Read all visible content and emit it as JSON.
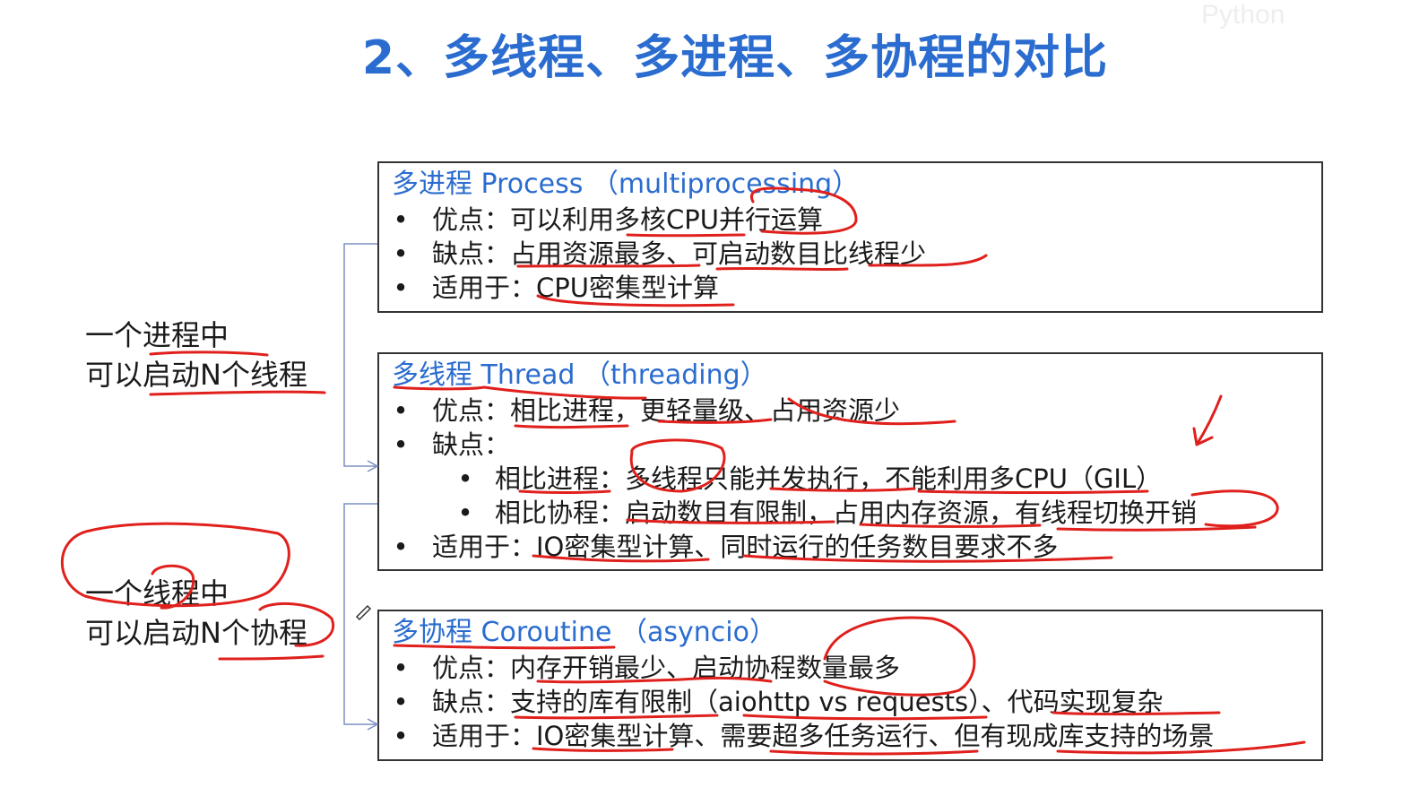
{
  "watermark": "Python",
  "title": "2、多线程、多进程、多协程的对比",
  "side": {
    "process_line1": "一个进程中",
    "process_line2": "可以启动N个线程",
    "thread_line1": "一个线程中",
    "thread_line2": "可以启动N个协程"
  },
  "process": {
    "title": "多进程 Process （multiprocessing）",
    "rows": [
      "优点：可以利用多核CPU并行运算",
      "缺点：占用资源最多、可启动数目比线程少",
      "适用于：CPU密集型计算"
    ]
  },
  "thread": {
    "title": "多线程 Thread （threading）",
    "rows": [
      "优点：相比进程，更轻量级、占用资源少",
      "缺点：",
      "相比进程：多线程只能并发执行，不能利用多CPU（GIL）",
      "相比协程：启动数目有限制，占用内存资源，有线程切换开销",
      "适用于：IO密集型计算、同时运行的任务数目要求不多"
    ]
  },
  "coroutine": {
    "title": "多协程 Coroutine （asyncio）",
    "rows": [
      "优点：内存开销最少、启动协程数量最多",
      "缺点：支持的库有限制（aiohttp vs requests）、代码实现复杂",
      "适用于：IO密集型计算、需要超多任务运行、但有现成库支持的场景"
    ]
  },
  "bullet_char": "•",
  "annotation_color": "#e0201c",
  "connector_color": "#7a8fc4"
}
